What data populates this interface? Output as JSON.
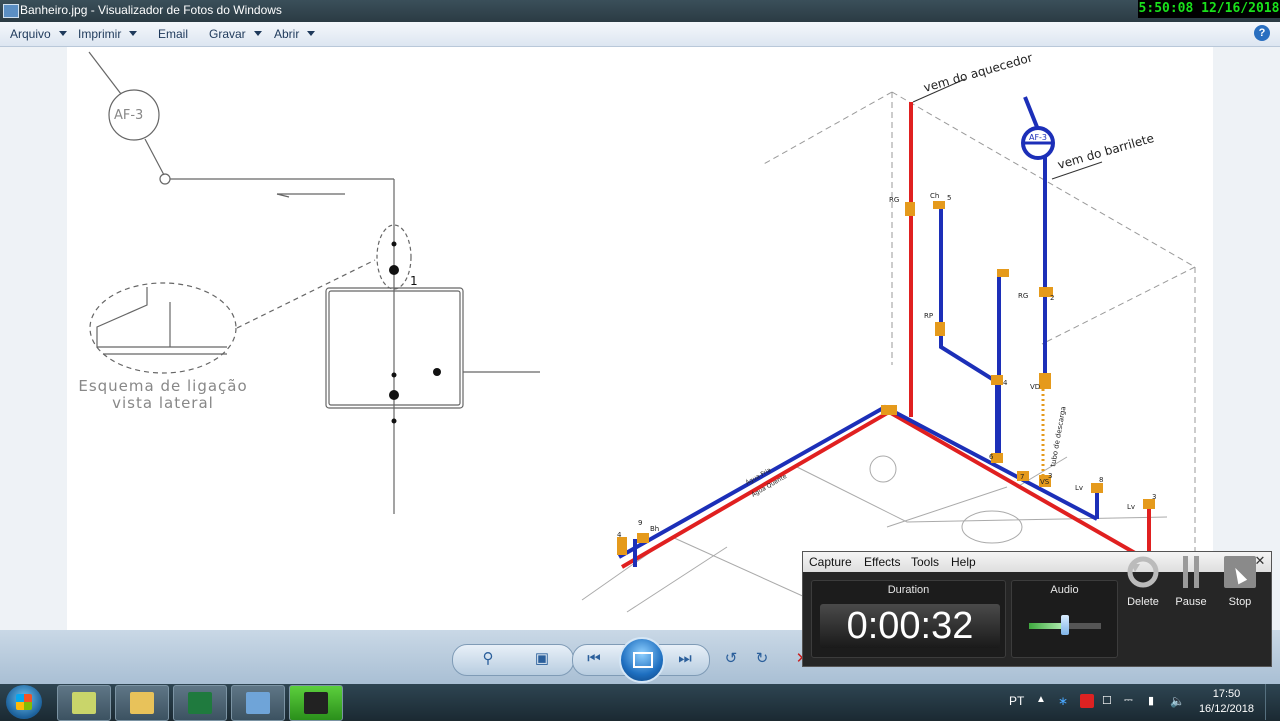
{
  "window": {
    "title": "Banheiro.jpg - Visualizador de Fotos do Windows",
    "clock": "5:50:08  12/16/2018"
  },
  "menubar": {
    "items": [
      {
        "label": "Arquivo",
        "dropdown": true
      },
      {
        "label": "Imprimir",
        "dropdown": true
      },
      {
        "label": "Email",
        "dropdown": false
      },
      {
        "label": "Gravar",
        "dropdown": true
      },
      {
        "label": "Abrir",
        "dropdown": true
      }
    ],
    "help": "?"
  },
  "drawing": {
    "af_label_left": "AF-3",
    "af_label_right": "AF-3",
    "node_number": "1",
    "caption_line1": "Esquema de ligação",
    "caption_line2": "vista lateral",
    "hot_source": "vem do aquecedor",
    "cold_source": "vem do barrilete",
    "fixture_labels": {
      "rg_top": "RG",
      "ch": "Ch",
      "n5": "5",
      "rp": "RP",
      "rg_mid": "RG",
      "n2": "2",
      "n4_mid": "4",
      "vd": "VD",
      "n6": "6",
      "n7": "7",
      "vs": "VS",
      "n3_mid": "3",
      "lv_mid": "Lv",
      "n8": "8",
      "lv_right": "Lv",
      "n3_right": "3",
      "n4_left": "4",
      "n9": "9",
      "bh": "Bh",
      "tubo": "tubo de descarga",
      "agua_fria": "Água Fria",
      "agua_quente": "Água Quente"
    }
  },
  "recorder": {
    "menu": [
      "Capture",
      "Effects",
      "Tools",
      "Help"
    ],
    "minimize": "–",
    "close": "✕",
    "duration_label": "Duration",
    "duration_value": "0:00:32",
    "audio_label": "Audio",
    "audio_level": 0.5,
    "buttons": [
      "Delete",
      "Pause",
      "Stop"
    ]
  },
  "taskbar": {
    "language": "PT",
    "time": "17:50",
    "date": "16/12/2018"
  },
  "colors": {
    "hot_pipe": "#e02020",
    "cold_pipe": "#1c2fb8",
    "fitting": "#e59a1c",
    "clock_text": "#19e11b"
  },
  "icons": [
    "app-icon",
    "help-icon",
    "zoom-icon",
    "fit-icon",
    "previous-icon",
    "slideshow-icon",
    "next-icon",
    "rotate-left-icon",
    "rotate-right-icon",
    "delete-icon",
    "start-icon",
    "windows-flag-icon",
    "notes-icon",
    "folder-icon",
    "excel-icon",
    "photo-viewer-icon",
    "recorder-icon",
    "delete-icon",
    "pause-icon",
    "stop-icon",
    "show-hidden-icons",
    "bluetooth-icon",
    "network-icon",
    "volume-icon",
    "mouse-cursor-icon"
  ]
}
